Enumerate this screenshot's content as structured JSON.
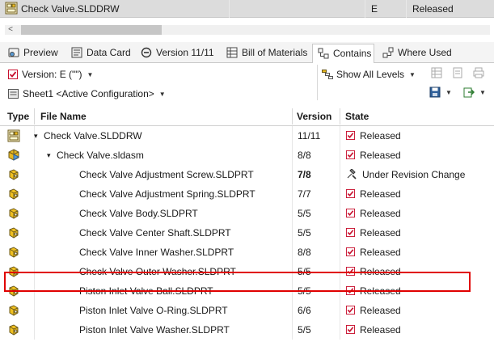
{
  "top_row": {
    "file_name": "Check Valve.SLDDRW",
    "version": "E",
    "state": "Released"
  },
  "scrollbar": {
    "left_arrow": "<"
  },
  "tabs": [
    {
      "label": "Preview",
      "icon": "preview-icon"
    },
    {
      "label": "Data Card",
      "icon": "data-card-icon"
    },
    {
      "label": "Version 11/11",
      "icon": "version-icon"
    },
    {
      "label": "Bill of Materials",
      "icon": "bom-icon"
    },
    {
      "label": "Contains",
      "icon": "contains-icon",
      "active": true
    },
    {
      "label": "Where Used",
      "icon": "where-used-icon"
    }
  ],
  "toolbar": {
    "version_label": "Version: E (\"\")",
    "configuration": "Sheet1 <Active Configuration>",
    "show_levels": "Show All Levels"
  },
  "grid": {
    "headers": {
      "type": "Type",
      "file_name": "File Name",
      "version": "Version",
      "state": "State"
    },
    "rows": [
      {
        "icon": "drawing-icon",
        "name": "Check Valve.SLDDRW",
        "indent": 1,
        "expander": "▾",
        "version": "11/11",
        "state": "Released",
        "state_icon": "released-check-icon"
      },
      {
        "icon": "assembly-icon",
        "name": "Check Valve.sldasm",
        "indent": 2,
        "expander": "▾",
        "version": "8/8",
        "state": "Released",
        "state_icon": "released-check-icon"
      },
      {
        "icon": "part-icon",
        "name": "Check Valve Adjustment Screw.SLDPRT",
        "indent": 3,
        "version": "7/8",
        "state": "Under Revision Change",
        "state_icon": "revision-change-icon",
        "bold_version": true,
        "highlighted": true
      },
      {
        "icon": "part-icon",
        "name": "Check Valve Adjustment Spring.SLDPRT",
        "indent": 3,
        "version": "7/7",
        "state": "Released",
        "state_icon": "released-check-icon"
      },
      {
        "icon": "part-icon",
        "name": "Check Valve Body.SLDPRT",
        "indent": 3,
        "version": "5/5",
        "state": "Released",
        "state_icon": "released-check-icon"
      },
      {
        "icon": "part-icon",
        "name": "Check Valve Center Shaft.SLDPRT",
        "indent": 3,
        "version": "5/5",
        "state": "Released",
        "state_icon": "released-check-icon"
      },
      {
        "icon": "part-icon",
        "name": "Check Valve Inner Washer.SLDPRT",
        "indent": 3,
        "version": "8/8",
        "state": "Released",
        "state_icon": "released-check-icon"
      },
      {
        "icon": "part-icon",
        "name": "Check Valve Outer Washer.SLDPRT",
        "indent": 3,
        "version": "5/5",
        "state": "Released",
        "state_icon": "released-check-icon"
      },
      {
        "icon": "part-icon",
        "name": "Piston Inlet Valve Ball.SLDPRT",
        "indent": 3,
        "version": "5/5",
        "state": "Released",
        "state_icon": "released-check-icon"
      },
      {
        "icon": "part-icon",
        "name": "Piston Inlet Valve O-Ring.SLDPRT",
        "indent": 3,
        "version": "6/6",
        "state": "Released",
        "state_icon": "released-check-icon"
      },
      {
        "icon": "part-icon",
        "name": "Piston Inlet Valve Washer.SLDPRT",
        "indent": 3,
        "version": "5/5",
        "state": "Released",
        "state_icon": "released-check-icon"
      }
    ]
  },
  "colors": {
    "highlight": "#e00000",
    "released_red": "#c8102e",
    "part_yellow": "#e8b820",
    "header_bg": "#dcdcdc"
  }
}
